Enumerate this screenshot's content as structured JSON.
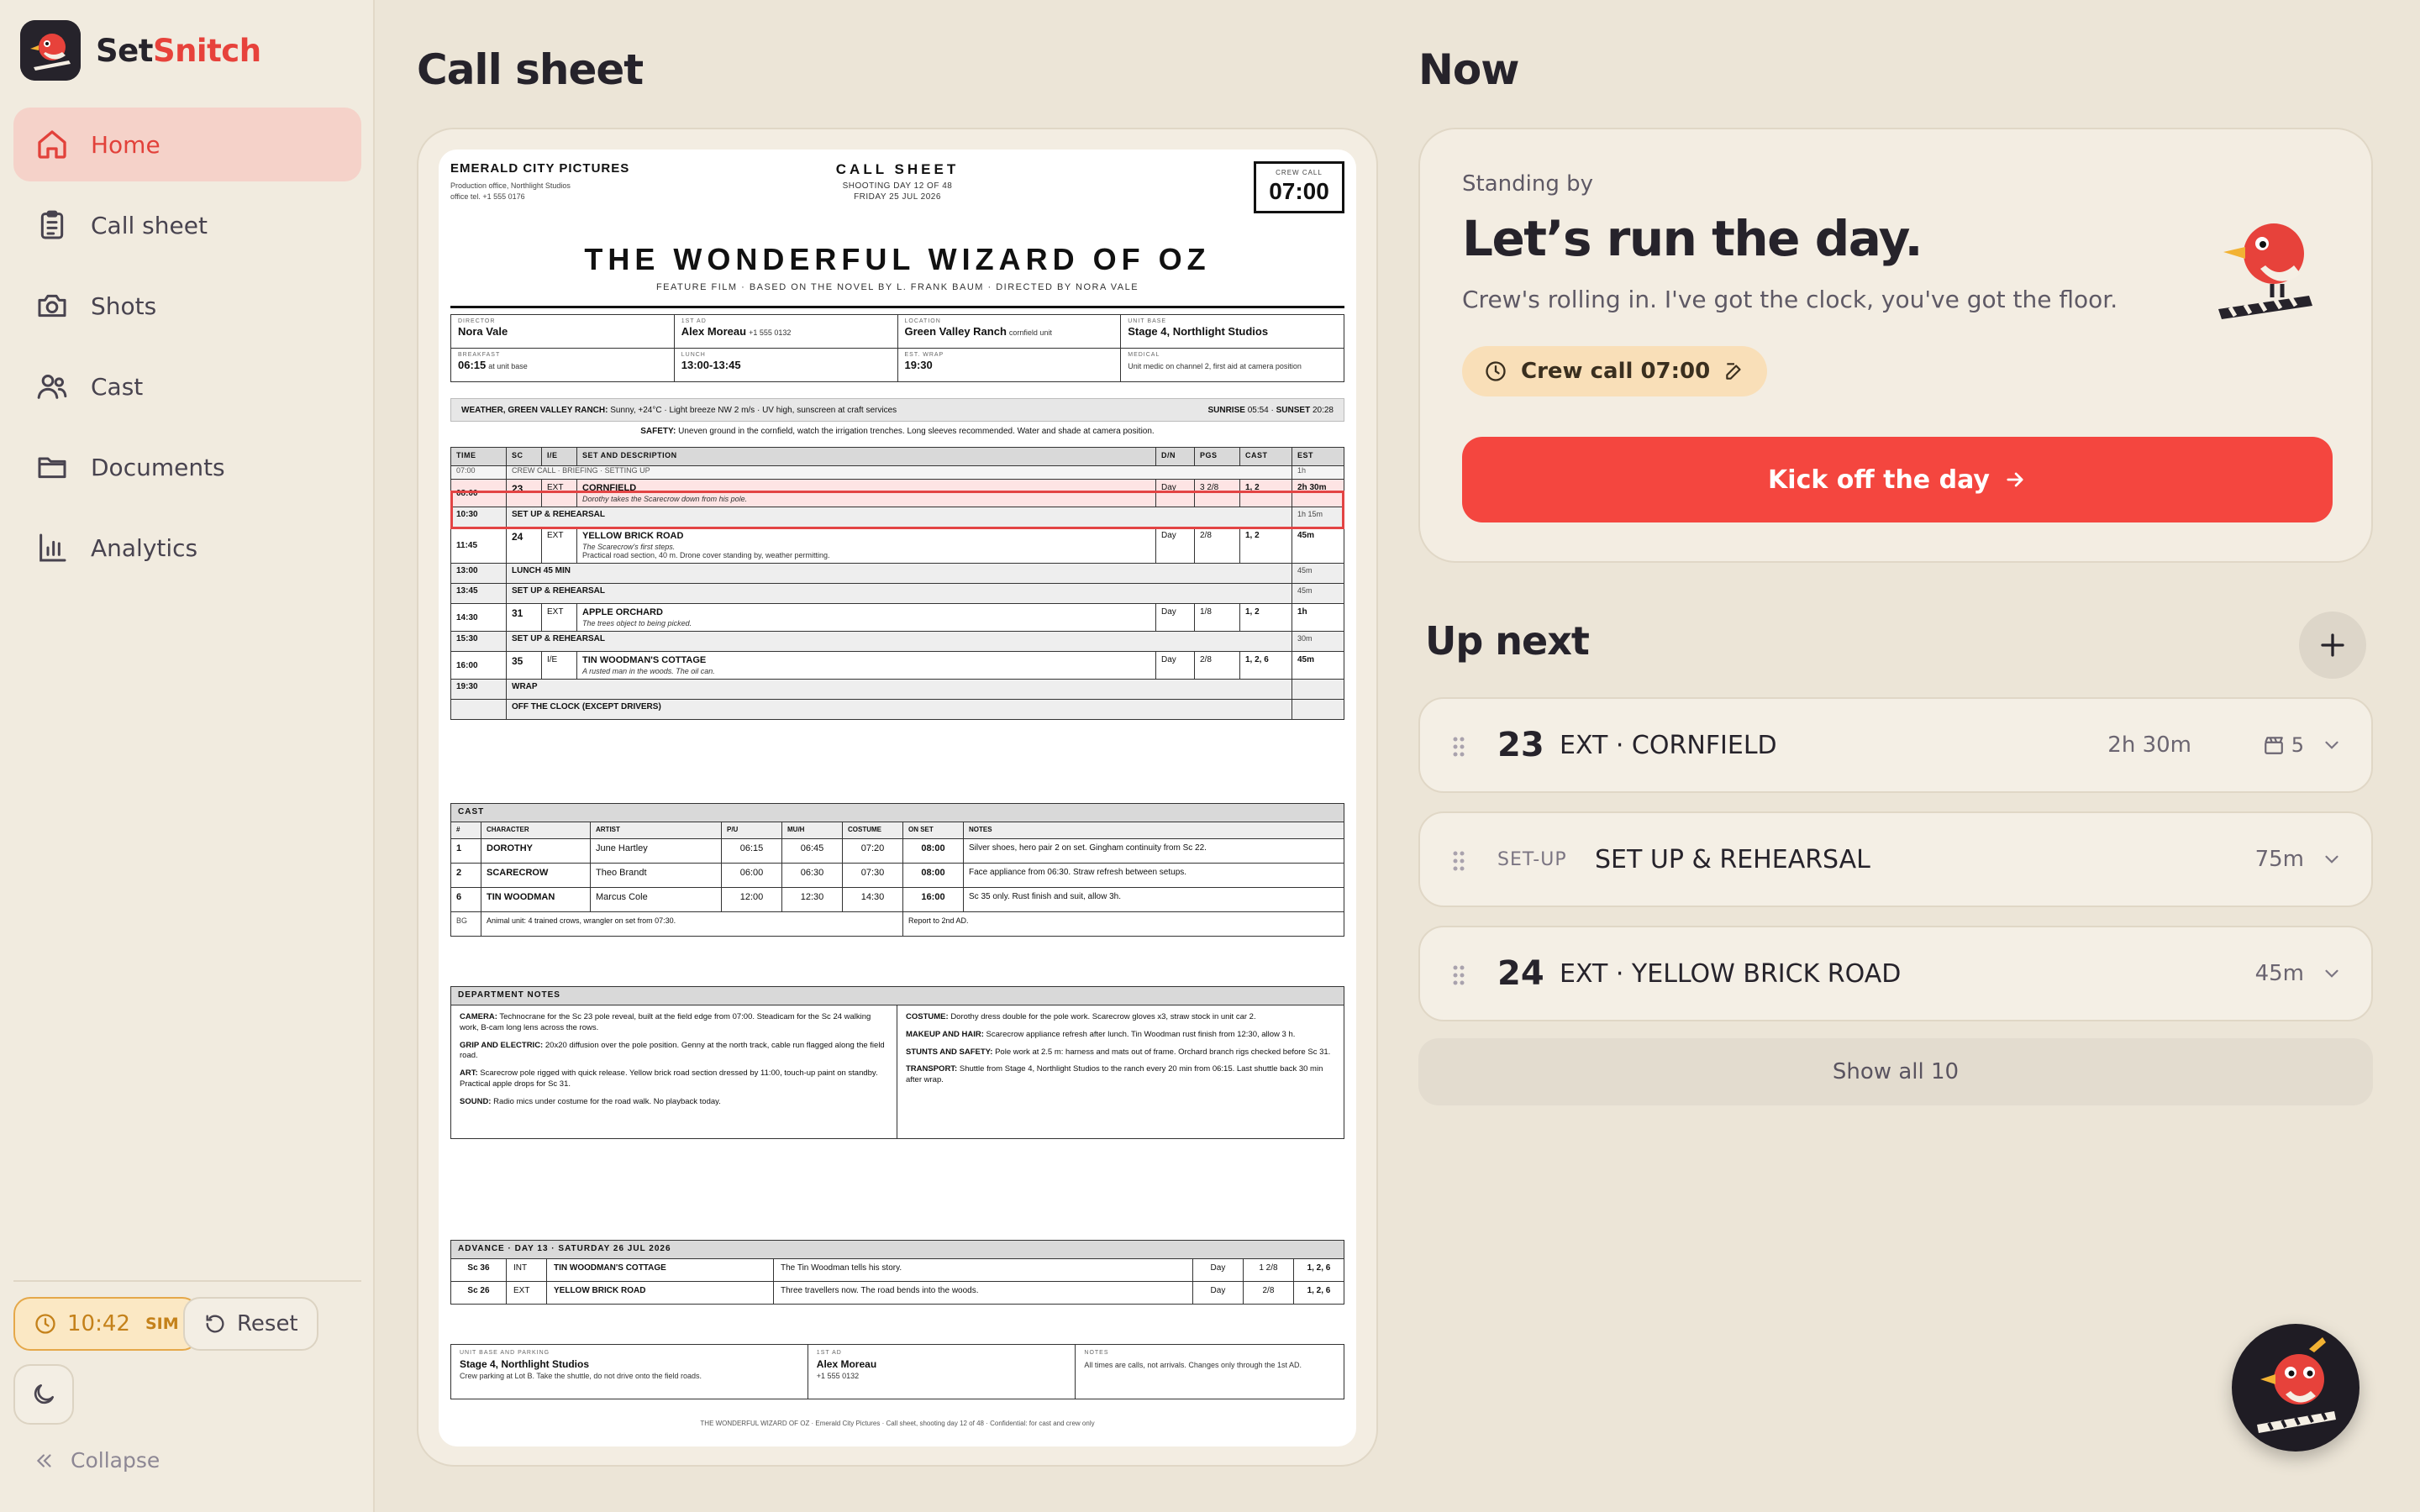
{
  "app": {
    "name_part1": "Set",
    "name_part2": "Snitch"
  },
  "nav": [
    {
      "label": "Home",
      "icon": "home-icon",
      "active": true
    },
    {
      "label": "Call sheet",
      "icon": "clipboard-icon"
    },
    {
      "label": "Shots",
      "icon": "camera-icon"
    },
    {
      "label": "Cast",
      "icon": "users-icon"
    },
    {
      "label": "Documents",
      "icon": "folder-icon"
    },
    {
      "label": "Analytics",
      "icon": "bar-chart-icon"
    }
  ],
  "sidebar_footer": {
    "clock": "10:42",
    "sim": "SIM",
    "reset": "Reset",
    "collapse": "Collapse"
  },
  "headings": {
    "call_sheet": "Call sheet",
    "now": "Now",
    "up_next": "Up next"
  },
  "sheet": {
    "company": "EMERALD CITY PICTURES",
    "company_line1": "Production office, Northlight Studios",
    "company_line2": "office tel. +1 555 0176",
    "title": "CALL SHEET",
    "day_line": "SHOOTING DAY 12 OF 48",
    "date_line": "FRIDAY 25 JUL 2026",
    "crew_call_label": "CREW CALL",
    "crew_call": "07:00",
    "film": "THE WONDERFUL WIZARD OF OZ",
    "film_sub": "FEATURE FILM · BASED ON THE NOVEL BY L. FRANK BAUM · DIRECTED BY NORA VALE",
    "info": {
      "director_l": "DIRECTOR",
      "director": "Nora Vale",
      "ad_l": "1ST AD",
      "ad": "Alex Moreau",
      "ad_x": "+1 555 0132",
      "location_l": "LOCATION",
      "location": "Green Valley Ranch",
      "location_x": "cornfield unit",
      "base_l": "UNIT BASE",
      "base": "Stage 4, Northlight Studios",
      "breakfast_l": "BREAKFAST",
      "breakfast": "06:15",
      "breakfast_x": "at unit base",
      "lunch_l": "LUNCH",
      "lunch": "13:00-13:45",
      "wrap_l": "EST. WRAP",
      "wrap": "19:30",
      "medical_l": "MEDICAL",
      "medical": "Unit medic on channel 2, first aid at camera position"
    },
    "weather_label": "WEATHER, GREEN VALLEY RANCH:",
    "weather": "Sunny, +24°C · Light breeze NW 2 m/s · UV high, sunscreen at craft services",
    "sunrise_label": "SUNRISE",
    "sunrise": "05:54",
    "sunset_label": "SUNSET",
    "sunset": "20:28",
    "safety_label": "SAFETY:",
    "safety": "Uneven ground in the cornfield, watch the irrigation trenches. Long sleeves recommended. Water and shade at camera position.",
    "sched_headers": [
      "TIME",
      "SC",
      "I/E",
      "SET AND DESCRIPTION",
      "D/N",
      "PGS",
      "CAST",
      "EST"
    ],
    "crew_call_row": {
      "time": "07:00",
      "label": "CREW CALL · BRIEFING · SETTING UP",
      "est": "1h"
    },
    "rows": [
      {
        "type": "scene",
        "time": "08:00",
        "sc": "23",
        "ie": "EXT",
        "set": "CORNFIELD",
        "desc": "Dorothy takes the Scarecrow down from his pole.",
        "note": "",
        "dn": "Day",
        "pgs": "3 2/8",
        "cast": "1, 2",
        "est": "2h 30m",
        "current": true
      },
      {
        "type": "band",
        "time": "10:30",
        "label": "SET UP & REHEARSAL",
        "est": "1h 15m"
      },
      {
        "type": "scene",
        "time": "11:45",
        "sc": "24",
        "ie": "EXT",
        "set": "YELLOW BRICK ROAD",
        "desc": "The Scarecrow's first steps.",
        "note": "Practical road section, 40 m. Drone cover standing by, weather permitting.",
        "dn": "Day",
        "pgs": "2/8",
        "cast": "1, 2",
        "est": "45m"
      },
      {
        "type": "band",
        "time": "13:00",
        "label": "LUNCH 45 MIN",
        "est": "45m"
      },
      {
        "type": "band",
        "time": "13:45",
        "label": "SET UP & REHEARSAL",
        "est": "45m"
      },
      {
        "type": "scene",
        "time": "14:30",
        "sc": "31",
        "ie": "EXT",
        "set": "APPLE ORCHARD",
        "desc": "The trees object to being picked.",
        "note": "",
        "dn": "Day",
        "pgs": "1/8",
        "cast": "1, 2",
        "est": "1h"
      },
      {
        "type": "band",
        "time": "15:30",
        "label": "SET UP & REHEARSAL",
        "est": "30m"
      },
      {
        "type": "scene",
        "time": "16:00",
        "sc": "35",
        "ie": "I/E",
        "set": "TIN WOODMAN'S COTTAGE",
        "desc": "A rusted man in the woods. The oil can.",
        "note": "",
        "dn": "Day",
        "pgs": "2/8",
        "cast": "1, 2, 6",
        "est": "45m"
      },
      {
        "type": "band",
        "time": "19:30",
        "label": "WRAP",
        "est": ""
      },
      {
        "type": "band",
        "time": "",
        "label": "OFF THE CLOCK (EXCEPT DRIVERS)",
        "est": ""
      }
    ],
    "cast_caption": "CAST",
    "cast_headers": [
      "#",
      "CHARACTER",
      "ARTIST",
      "P/U",
      "MU/H",
      "COSTUME",
      "ON SET",
      "NOTES"
    ],
    "cast": [
      {
        "n": "1",
        "character": "DOROTHY",
        "artist": "June Hartley",
        "pu": "06:15",
        "muh": "06:45",
        "costume": "07:20",
        "onset": "08:00",
        "notes": "Silver shoes, hero pair 2 on set. Gingham continuity from Sc 22."
      },
      {
        "n": "2",
        "character": "SCARECROW",
        "artist": "Theo Brandt",
        "pu": "06:00",
        "muh": "06:30",
        "costume": "07:30",
        "onset": "08:00",
        "notes": "Face appliance from 06:30. Straw refresh between setups."
      },
      {
        "n": "6",
        "character": "TIN WOODMAN",
        "artist": "Marcus Cole",
        "pu": "12:00",
        "muh": "12:30",
        "costume": "14:30",
        "onset": "16:00",
        "notes": "Sc 35 only. Rust finish and suit, allow 3h."
      }
    ],
    "bg_label": "BG",
    "bg": "Animal unit: 4 trained crows, wrangler on set from 07:30.",
    "bg_note": "Report to 2nd AD.",
    "dept_caption": "DEPARTMENT NOTES",
    "dept_left": [
      {
        "k": "CAMERA:",
        "v": "Technocrane for the Sc 23 pole reveal, built at the field edge from 07:00. Steadicam for the Sc 24 walking work, B-cam long lens across the rows."
      },
      {
        "k": "GRIP AND ELECTRIC:",
        "v": "20x20 diffusion over the pole position. Genny at the north track, cable run flagged along the field road."
      },
      {
        "k": "ART:",
        "v": "Scarecrow pole rigged with quick release. Yellow brick road section dressed by 11:00, touch-up paint on standby. Practical apple drops for Sc 31."
      },
      {
        "k": "SOUND:",
        "v": "Radio mics under costume for the road walk. No playback today."
      }
    ],
    "dept_right": [
      {
        "k": "COSTUME:",
        "v": "Dorothy dress double for the pole work. Scarecrow gloves x3, straw stock in unit car 2."
      },
      {
        "k": "MAKEUP AND HAIR:",
        "v": "Scarecrow appliance refresh after lunch. Tin Woodman rust finish from 12:30, allow 3 h."
      },
      {
        "k": "STUNTS AND SAFETY:",
        "v": "Pole work at 2.5 m: harness and mats out of frame. Orchard branch rigs checked before Sc 31."
      },
      {
        "k": "TRANSPORT:",
        "v": "Shuttle from Stage 4, Northlight Studios to the ranch every 20 min from 06:15. Last shuttle back 30 min after wrap."
      }
    ],
    "adv_caption": "ADVANCE · DAY 13 · SATURDAY 26 JUL 2026",
    "advance": [
      {
        "sc": "Sc 36",
        "ie": "INT",
        "set": "TIN WOODMAN'S COTTAGE",
        "desc": "The Tin Woodman tells his story.",
        "dn": "Day",
        "pgs": "1 2/8",
        "cast": "1, 2, 6"
      },
      {
        "sc": "Sc 26",
        "ie": "EXT",
        "set": "YELLOW BRICK ROAD",
        "desc": "Three travellers now. The road bends into the woods.",
        "dn": "Day",
        "pgs": "2/8",
        "cast": "1, 2, 6"
      }
    ],
    "foot": {
      "base_l": "UNIT BASE AND PARKING",
      "base": "Stage 4, Northlight Studios",
      "base_x": "Crew parking at Lot B. Take the shuttle, do not drive onto the field roads.",
      "ad_l": "1ST AD",
      "ad": "Alex Moreau",
      "ad_x": "+1 555 0132",
      "notes_l": "NOTES",
      "notes": "All times are calls, not arrivals. Changes only through the 1st AD."
    },
    "footer": "THE WONDERFUL WIZARD OF OZ · Emerald City Pictures · Call sheet, shooting day 12 of 48 · Confidential: for cast and crew only"
  },
  "now": {
    "eyebrow": "Standing by",
    "headline": "Let’s run the day.",
    "sub": "Crew's rolling in. I've got the clock, you've got the floor.",
    "crew_call": "Crew call 07:00",
    "kick": "Kick off the day"
  },
  "up_next": [
    {
      "num": "23",
      "name": "EXT · CORNFIELD",
      "duration": "2h 30m",
      "count": "5"
    },
    {
      "num": "SET-UP",
      "name": "SET UP & REHEARSAL",
      "duration": "75m"
    },
    {
      "num": "24",
      "name": "EXT · YELLOW BRICK ROAD",
      "duration": "45m"
    }
  ],
  "show_all": "Show all 10",
  "colors": {
    "accent": "#f4463f",
    "sidebar_active": "#f5d2c9",
    "clock_amber": "#e5a84a",
    "background": "#ece5d7"
  }
}
